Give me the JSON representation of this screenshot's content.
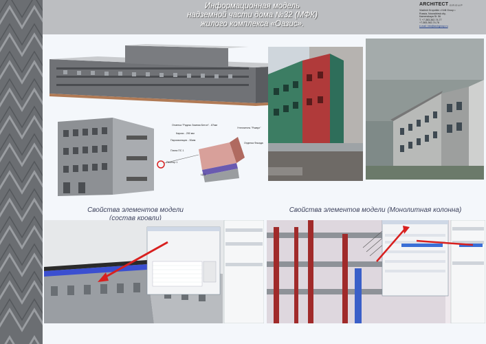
{
  "header": {
    "title_lines": [
      "Информационная модель",
      "надземной части дома №32 (МФК)",
      "жилого комплекса «Оазис»."
    ]
  },
  "brand": {
    "name": "ARCHITECT",
    "sub": "GROUP",
    "lines": [
      "Vladimir Kropotkin • Kirill Group •",
      "Russia, Novosibirsk city,",
      "Kamenskaya St. 56",
      "T. +7-383-362-74-77",
      "+7-383-362-74-78",
      "e-mail: info@archgroup.ru"
    ]
  },
  "callouts": {
    "c1": "Отметка \"Ридекс Зимняя Бетон\" - 87мм",
    "c2": "Каркас - 250 мм",
    "c3": "Пароизоляция - 30мм",
    "c4": "Плита ПС 1",
    "c5": "Пес/пер 1",
    "c6": "Утеплитель \"Роквул\"",
    "c7": "Отделка Фасада",
    "c8": "ЦС1"
  },
  "captions": {
    "roof": [
      "Свойства элементов модели",
      "(состав кровли)"
    ],
    "column": "Свойства элементов модели (Монолитная колонна)"
  },
  "colors": {
    "accent": "#d8201f",
    "header": "#bcbec1",
    "band": "#6b6e72"
  }
}
